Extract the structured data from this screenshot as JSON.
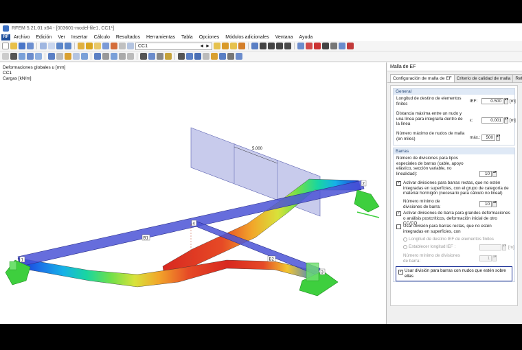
{
  "window": {
    "title": "RFEM 5.21.01 x64 - [003601-model-file1, CC1*]"
  },
  "menu": {
    "logo": "RF",
    "items": [
      "Archivo",
      "Edición",
      "Ver",
      "Insertar",
      "Cálculo",
      "Resultados",
      "Herramientas",
      "Tabla",
      "Opciones",
      "Módulos adicionales",
      "Ventana",
      "Ayuda"
    ]
  },
  "toolbar": {
    "load_case": "CC1",
    "load_case_arrows": "◄ ►"
  },
  "viewport": {
    "info_lines": [
      "Deformaciones globales u [mm]",
      "CC1",
      "Cargas [kN/m]"
    ],
    "dimension_label": "5.000",
    "node_labels": [
      "1",
      "2",
      "3",
      "4"
    ],
    "member_labels": [
      "B1",
      "B2"
    ],
    "colors": {
      "member": "#4b53d6",
      "support": "#3ecf3e",
      "load_plane": "#9aa0dd"
    }
  },
  "panel": {
    "title": "Malla de EF",
    "tabs": [
      "Configuración de malla de EF",
      "Criterio de calidad de malla",
      "Refinam"
    ],
    "general": {
      "header": "General",
      "target_length_label": "Longitud de destino de elementos finitos",
      "target_length_symbol": "lEF:",
      "target_length_value": "0.500",
      "target_length_unit": "[m]",
      "max_distance_label": "Distancia máxima entre un nudo y una línea para integrarla dentro de la línea",
      "max_distance_symbol": "ε:",
      "max_distance_value": "0.001",
      "max_distance_unit": "[m]",
      "max_nodes_label": "Número máximo de nudos de malla (en miles)",
      "max_nodes_symbol": "máx.:",
      "max_nodes_value": "500"
    },
    "barras": {
      "header": "Barras",
      "divisions_label": "Número de divisiones para tipos especiales de barras (cable, apoyo elástico, sección variable, no linealidad):",
      "divisions_value": "10",
      "activate_straight_label": "Activar divisiones para barras rectas, que no estén integradas en superficies, con el grupo de categoría de material hormigón (necesario para cálculo no lineal)",
      "min_divisions_label": "Número mínimo de divisiones de barra:",
      "min_divisions_value": "10",
      "activate_large_label": "Activar divisiones de barra para grandes deformaciones o análisis postcríticos, deformación inicial de otro CC/CO",
      "use_division_label": "Usar división para barras rectas, que no estén integradas en superficies, con",
      "radio_target_label": "Longitud de destino lEF de elementos finitos",
      "radio_establish_label": "Establecer longitud lEF :",
      "establish_unit": "[m]",
      "min_divisions2_label": "Número mínimo de divisiones de barra:",
      "min_divisions2_value": "1",
      "use_nodes_label": "Usar división para barras con nudos que estén sobre ellas"
    }
  }
}
